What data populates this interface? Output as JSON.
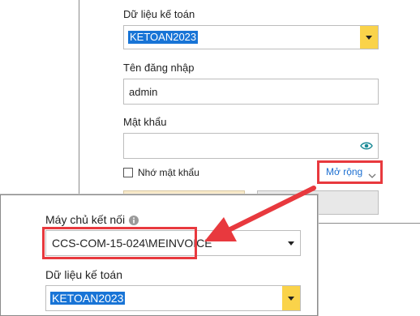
{
  "top_form": {
    "data_label": "Dữ liệu kế toán",
    "data_value": "KETOAN2023",
    "username_label": "Tên đăng nhập",
    "username_value": "admin",
    "password_label": "Mật khẩu",
    "password_value": "",
    "remember_label": "Nhớ mật khẩu",
    "expand_label": "Mở rộng"
  },
  "bottom_form": {
    "server_label": "Máy chủ kết nối",
    "server_value": "CCS-COM-15-024\\MEINVOICE",
    "data_label": "Dữ liệu kế toán",
    "data_value": "KETOAN2023"
  },
  "icons": {
    "eye": "eye-icon",
    "info": "info-icon",
    "chevron": "chevron-down-icon",
    "arrow": "arrow-annotation"
  },
  "colors": {
    "highlight": "#1874d6",
    "dropdown_button": "#fad34a",
    "annotation_red": "#e8393e",
    "link_blue": "#1c6fd1"
  }
}
